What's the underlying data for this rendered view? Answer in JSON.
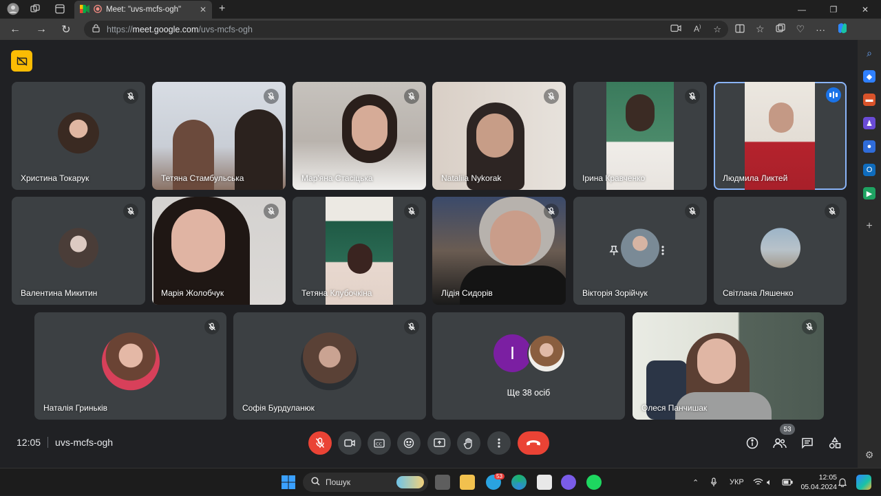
{
  "browser": {
    "tab_title": "Meet: \"uvs-mcfs-ogh\"",
    "url_scheme": "https://",
    "url_host": "meet.google.com",
    "url_path": "/uvs-mcfs-ogh"
  },
  "tiles": [
    {
      "name": "Христина Токарук"
    },
    {
      "name": "Тетяна Стамбульська"
    },
    {
      "name": "Мар'яна Стасіцька"
    },
    {
      "name": "Nataliia Nykorak"
    },
    {
      "name": "Ірина Кравченко"
    },
    {
      "name": "Людмила Ликтей"
    },
    {
      "name": "Валентина Микитин"
    },
    {
      "name": "Марія Жолобчук"
    },
    {
      "name": "Тетяна Клубочкіна"
    },
    {
      "name": "Лідія Сидорів"
    },
    {
      "name": "Вікторія Зорійчук"
    },
    {
      "name": "Світлана Ляшенко"
    },
    {
      "name": "Наталія Гриньків"
    },
    {
      "name": "Софія Бурдуланюк"
    },
    {
      "name": "Ще 38 осіб",
      "avatar_letter": "І"
    },
    {
      "name": "Олеся Панчишак"
    }
  ],
  "meeting": {
    "time": "12:05",
    "code": "uvs-mcfs-ogh",
    "participants_count": "53"
  },
  "taskbar": {
    "search_placeholder": "Пошук",
    "telegram_badge": "53",
    "lang": "УКР",
    "clock_time": "12:05",
    "clock_date": "05.04.2024"
  },
  "colors": {
    "accent": "#8ab4f8",
    "hangup": "#ea4335",
    "tile_bg": "#3c4043",
    "badge": "#fbbc04"
  }
}
